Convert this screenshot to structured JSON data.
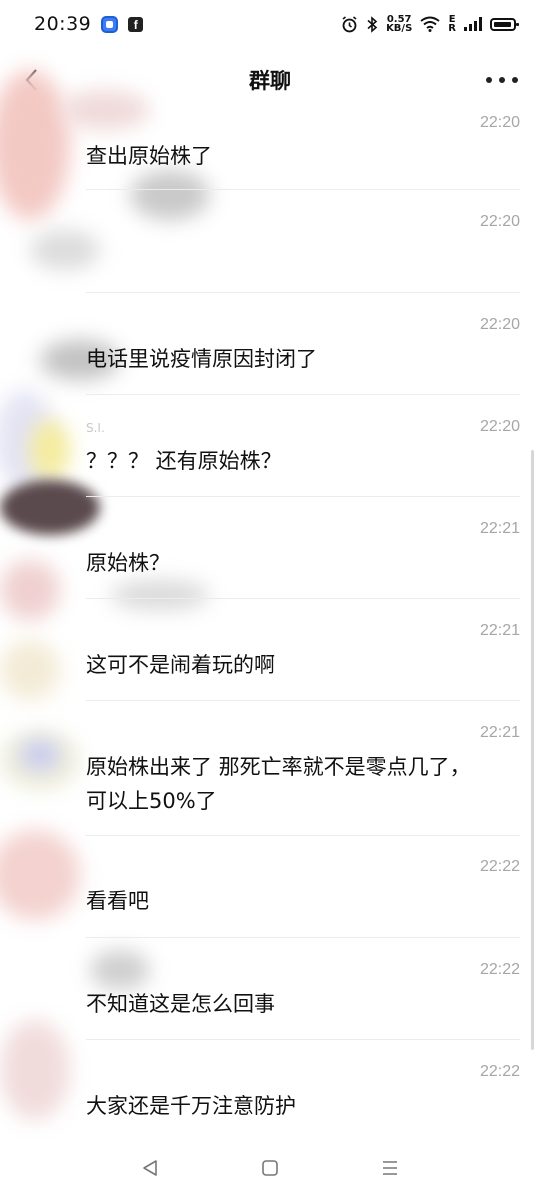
{
  "status_bar": {
    "time": "20:39",
    "net_speed_value": "0.57",
    "net_speed_unit": "KB/S",
    "network_label_top": "E",
    "network_label_bottom": "R"
  },
  "header": {
    "title": "群聊"
  },
  "messages": [
    {
      "time": "22:20",
      "text": "查出原始株了"
    },
    {
      "time": "22:20",
      "text": ""
    },
    {
      "time": "22:20",
      "text": "电话里说疫情原因封闭了"
    },
    {
      "time": "22:20",
      "sender": "S.I.",
      "text": "？？？ 还有原始株？"
    },
    {
      "time": "22:21",
      "text": "原始株？"
    },
    {
      "time": "22:21",
      "text": "这可不是闹着玩的啊"
    },
    {
      "time": "22:21",
      "text": "原始株出来了 那死亡率就不是零点几了，",
      "text2": "可以上50%了"
    },
    {
      "time": "22:22",
      "text": "看看吧"
    },
    {
      "time": "22:22",
      "text": "不知道这是怎么回事"
    },
    {
      "time": "22:22",
      "text": "大家还是千万注意防护"
    }
  ],
  "icons": {
    "back": "chevron-left-icon",
    "more": "more-horizontal-icon",
    "nav_back": "triangle-back-icon",
    "nav_home": "square-home-icon",
    "nav_menu": "hamburger-menu-icon"
  },
  "colors": {
    "background": "#ffffff",
    "text": "#111111",
    "timestamp": "#a6a6a6",
    "divider": "#ececec"
  }
}
